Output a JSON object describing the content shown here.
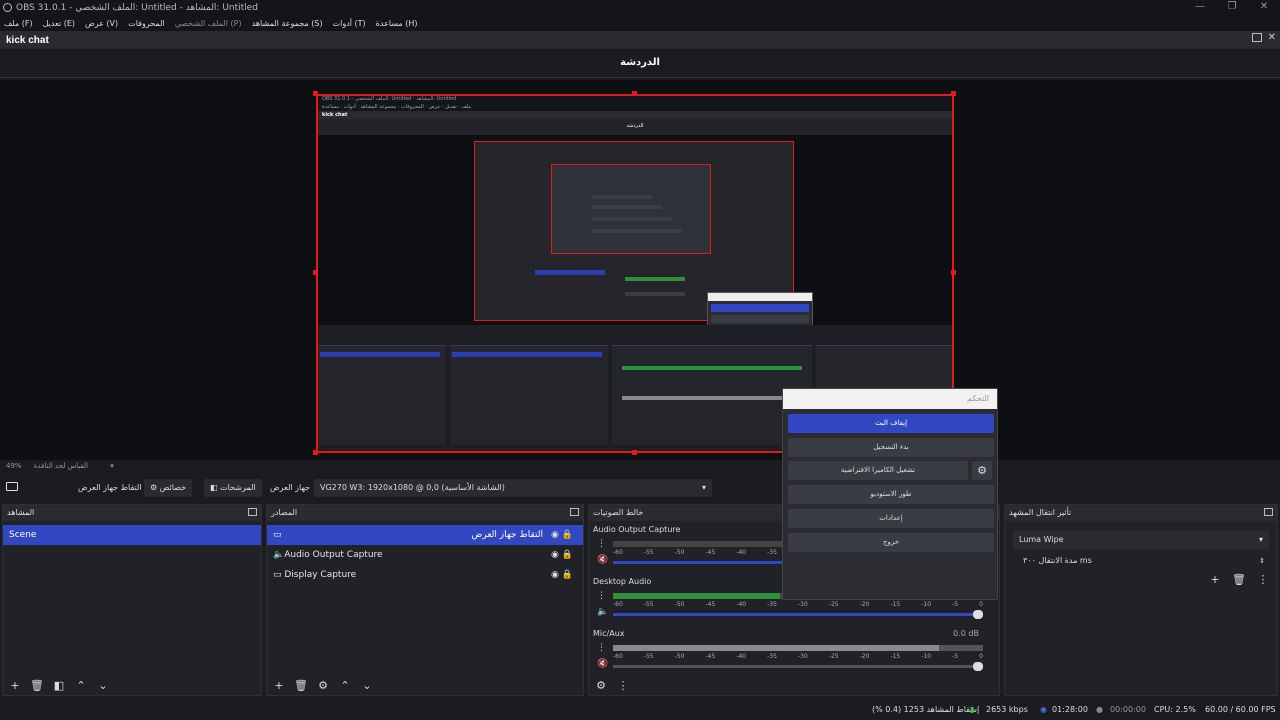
{
  "window": {
    "title": "OBS 31.0.1 - الملف الشخصي: Untitled - المشاهد: Untitled",
    "controls": [
      "—",
      "❐",
      "✕"
    ]
  },
  "menu": [
    {
      "label": "ملف (F)"
    },
    {
      "label": "تعديل (E)"
    },
    {
      "label": "عرض (V)"
    },
    {
      "label": "المحروفات"
    },
    {
      "label": "الملف الشخصي (P)"
    },
    {
      "label": "مجموعة المشاهد (S)"
    },
    {
      "label": "أدوات (T)"
    },
    {
      "label": "مساعدة (H)"
    }
  ],
  "dock_title": "kick chat",
  "chat_title": "الدردشة",
  "preview_inner": {
    "dock": "kick chat",
    "chat": "الدردشة"
  },
  "popup": {
    "header": "التحكم",
    "buttons": [
      "إيقاف البث",
      "بدء التسجيل",
      "تشغيل الكاميرا الافتراضية",
      "طور الاستوديو",
      "إعدادات",
      "خروج"
    ]
  },
  "status_row": {
    "zoom": "49%",
    "label": "القياس لحد النافذة"
  },
  "sourcebar": {
    "capture_label": "التقاط جهاز العرض",
    "properties": "خصائص",
    "filters": "المرشحات",
    "device_label": "جهاز العرض",
    "device_value": "VG270 W3: 1920x1080 @ 0,0 (الشاشة الأساسية)"
  },
  "scenes": {
    "title": "المشاهد",
    "items": [
      "Scene"
    ]
  },
  "sources": {
    "title": "المصادر",
    "items": [
      "التقاط جهاز العرض",
      "Audio Output Capture",
      "Display Capture"
    ]
  },
  "mixer": {
    "title": "خالط الصوتيات",
    "channels": [
      {
        "name": "Audio Output Capture",
        "db": ""
      },
      {
        "name": "Desktop Audio",
        "db": ""
      },
      {
        "name": "Mic/Aux",
        "db": "0.0 dB"
      }
    ],
    "ticks": [
      "-60",
      "-55",
      "-50",
      "-45",
      "-40",
      "-35",
      "-30",
      "-25",
      "-20",
      "-15",
      "-10",
      "-5",
      "0"
    ]
  },
  "transitions": {
    "title": "تأثير انتقال المشهد",
    "type": "Luma Wipe",
    "duration_label": "مدة الانتقال",
    "duration_value": "٣٠٠ ms"
  },
  "statusbar": {
    "dropped": "إسقاط المشاهد 1253 (0.4 %)",
    "bitrate": "2653 kbps",
    "stream_time": "01:28:00",
    "rec_time": "00:00:00",
    "cpu": "CPU: 2.5%",
    "fps": "60.00 / 60.00 FPS"
  }
}
